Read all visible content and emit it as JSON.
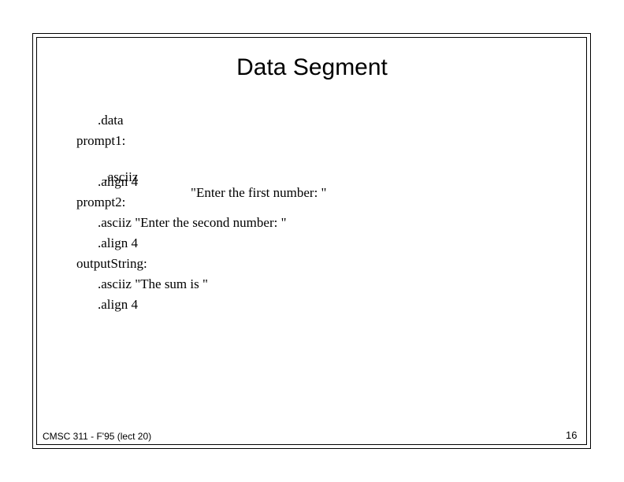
{
  "slide": {
    "title": "Data Segment",
    "lines": [
      {
        "text": ".data"
      },
      {
        "text": "prompt1:"
      },
      {
        "text": ".asciiz",
        "string": "\"Enter the first number: \""
      },
      {
        "text": ".align 4"
      },
      {
        "text": "prompt2:"
      },
      {
        "text": ".asciiz \"Enter the second number: \""
      },
      {
        "text": ".align 4"
      },
      {
        "text": "outputString:"
      },
      {
        "text": ".asciiz \"The sum is \""
      },
      {
        "text": ".align 4"
      }
    ],
    "footer": {
      "course": "CMSC 311 - F'95 (lect 20)",
      "page_number": "16"
    }
  }
}
